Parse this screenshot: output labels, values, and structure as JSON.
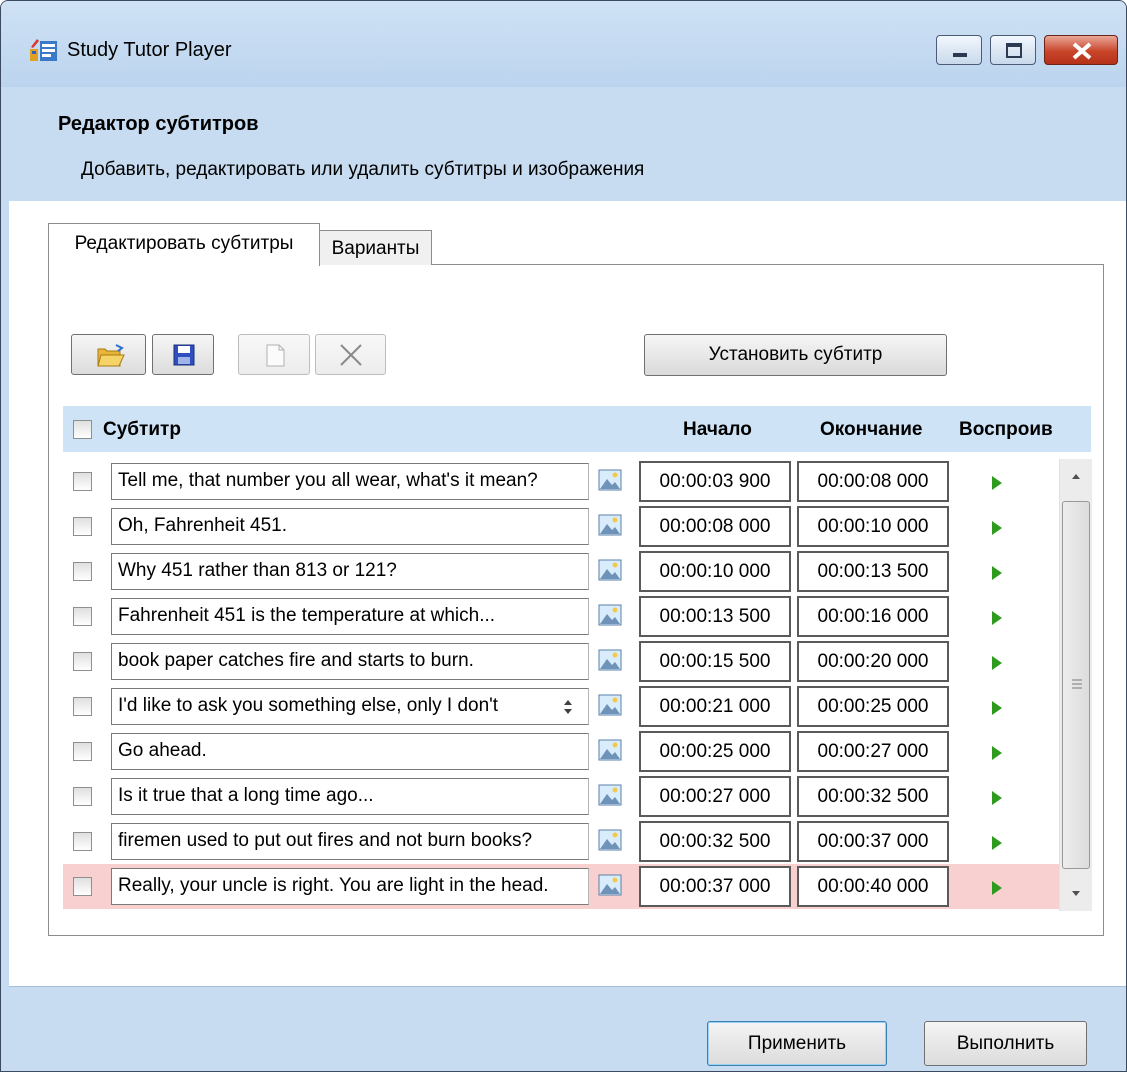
{
  "window": {
    "title": "Study Tutor Player"
  },
  "header": {
    "title": "Редактор субтитров",
    "subtitle": "Добавить, редактировать или удалить субтитры и изображения"
  },
  "tabs": [
    {
      "label": "Редактировать субтитры",
      "active": true
    },
    {
      "label": "Варианты",
      "active": false
    }
  ],
  "toolbar": {
    "open_icon": "open-folder-icon",
    "save_icon": "save-floppy-icon",
    "new_icon": "new-document-icon",
    "delete_icon": "delete-x-icon",
    "set_subtitle_label": "Установить субтитр"
  },
  "grid": {
    "columns": {
      "subtitle": "Субтитр",
      "start": "Начало",
      "end": "Окончание",
      "play": "Воспроив"
    },
    "rows": [
      {
        "text": "Tell me, that number you all wear, what's it mean?",
        "start": "00:00:03 900",
        "end": "00:00:08 000"
      },
      {
        "text": "Oh, Fahrenheit 451.",
        "start": "00:00:08 000",
        "end": "00:00:10 000"
      },
      {
        "text": "Why 451 rather than 813 or 121?",
        "start": "00:00:10 000",
        "end": "00:00:13 500"
      },
      {
        "text": "Fahrenheit 451 is the temperature at which...",
        "start": "00:00:13 500",
        "end": "00:00:16 000"
      },
      {
        "text": "book paper catches fire and starts to burn.",
        "start": "00:00:15 500",
        "end": "00:00:20 000"
      },
      {
        "text": "I'd like to ask you something else, only I don't",
        "start": "00:00:21 000",
        "end": "00:00:25 000"
      },
      {
        "text": "Go ahead.",
        "start": "00:00:25 000",
        "end": "00:00:27 000"
      },
      {
        "text": "Is it true that a long time ago...",
        "start": "00:00:27 000",
        "end": "00:00:32 500"
      },
      {
        "text": "firemen used to put out fires and not burn books?",
        "start": "00:00:32 500",
        "end": "00:00:37 000"
      },
      {
        "text": "Really, your uncle is right. You are light in the head.",
        "start": "00:00:37 000",
        "end": "00:00:40 000"
      }
    ],
    "selected_row_color": "#f9d0d0",
    "header_color": "#cfe3f7"
  },
  "footer": {
    "apply_label": "Применить",
    "run_label": "Выполнить"
  },
  "colors": {
    "chrome": "#c7dcf1",
    "play_green": "#2e9b1e"
  }
}
